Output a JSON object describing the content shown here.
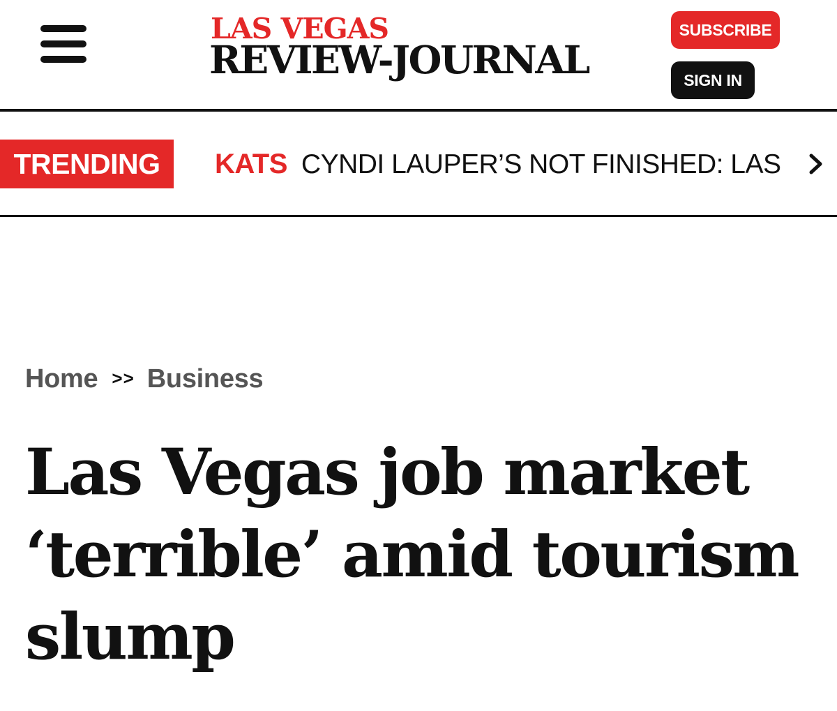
{
  "header": {
    "logo_top": "LAS VEGAS",
    "logo_bottom": "REVIEW-JOURNAL",
    "subscribe_label": "SUBSCRIBE",
    "signin_label": "SIGN IN",
    "menu_icon": "hamburger-menu-icon"
  },
  "trending": {
    "badge": "TRENDING",
    "tag": "KATS",
    "headline": "CYNDI LAUPER’S NOT FINISHED: LAS",
    "next_icon": "chevron-right-icon"
  },
  "breadcrumb": {
    "home": "Home",
    "separator": ">>",
    "section": "Business"
  },
  "article": {
    "headline": "Las Vegas job market ‘terrible’ amid tourism slump"
  },
  "colors": {
    "brand_red": "#e42828",
    "text_dark": "#111111",
    "breadcrumb_gray": "#555555"
  }
}
